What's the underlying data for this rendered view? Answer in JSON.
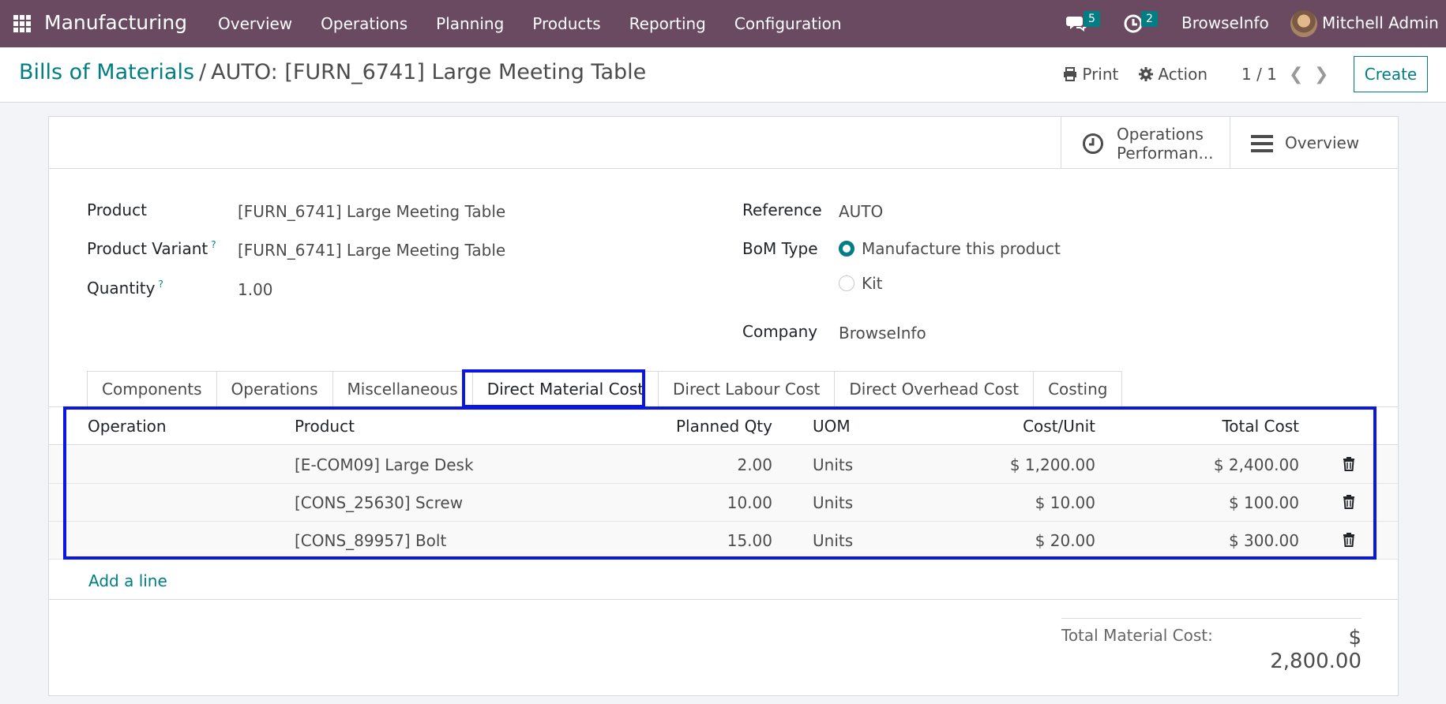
{
  "navbar": {
    "app_name": "Manufacturing",
    "menu": [
      "Overview",
      "Operations",
      "Planning",
      "Products",
      "Reporting",
      "Configuration"
    ],
    "chat_count": "5",
    "activity_count": "2",
    "company": "BrowseInfo",
    "user": "Mitchell Admin"
  },
  "control": {
    "breadcrumb_parent": "Bills of Materials",
    "breadcrumb_sep": "/",
    "breadcrumb_current": "AUTO: [FURN_6741] Large Meeting Table",
    "print_label": "Print",
    "action_label": "Action",
    "pager": "1 / 1",
    "create_label": "Create"
  },
  "smart_buttons": {
    "operations_line1": "Operations",
    "operations_line2": "Performan...",
    "overview": "Overview"
  },
  "form": {
    "product_label": "Product",
    "product_value": "[FURN_6741] Large Meeting Table",
    "variant_label": "Product Variant",
    "variant_help": "?",
    "variant_value": "[FURN_6741] Large Meeting Table",
    "quantity_label": "Quantity",
    "quantity_help": "?",
    "quantity_value": "1.00",
    "reference_label": "Reference",
    "reference_value": "AUTO",
    "bom_type_label": "BoM Type",
    "bom_type_option1": "Manufacture this product",
    "bom_type_option2": "Kit",
    "company_label": "Company",
    "company_value": "BrowseInfo"
  },
  "tabs": [
    "Components",
    "Operations",
    "Miscellaneous",
    "Direct Material Cost",
    "Direct Labour Cost",
    "Direct Overhead Cost",
    "Costing"
  ],
  "table": {
    "headers": {
      "operation": "Operation",
      "product": "Product",
      "planned_qty": "Planned Qty",
      "uom": "UOM",
      "cost_unit": "Cost/Unit",
      "total_cost": "Total Cost"
    },
    "rows": [
      {
        "operation": "",
        "product": "[E-COM09] Large Desk",
        "planned_qty": "2.00",
        "uom": "Units",
        "cost_unit": "$ 1,200.00",
        "total_cost": "$ 2,400.00"
      },
      {
        "operation": "",
        "product": "[CONS_25630] Screw",
        "planned_qty": "10.00",
        "uom": "Units",
        "cost_unit": "$ 10.00",
        "total_cost": "$ 100.00"
      },
      {
        "operation": "",
        "product": "[CONS_89957] Bolt",
        "planned_qty": "15.00",
        "uom": "Units",
        "cost_unit": "$ 20.00",
        "total_cost": "$ 300.00"
      }
    ],
    "add_line": "Add a line"
  },
  "totals": {
    "label": "Total Material Cost:",
    "value": "$ 2,800.00"
  },
  "colors": {
    "navbar": "#694a60",
    "accent": "#017e84",
    "highlight": "#0a16e6"
  }
}
